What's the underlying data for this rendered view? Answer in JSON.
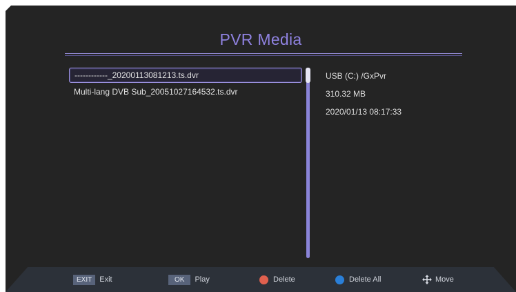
{
  "header": {
    "title": "PVR Media"
  },
  "files": [
    {
      "name": "------------_20200113081213.ts.dvr",
      "selected": true
    },
    {
      "name": "Multi-lang DVB Sub_20051027164532.ts.dvr",
      "selected": false
    }
  ],
  "details": {
    "path": "USB (C:) /GxPvr",
    "size": "310.32 MB",
    "datetime": "2020/01/13 08:17:33"
  },
  "footer": {
    "exit": {
      "key": "EXIT",
      "label": "Exit"
    },
    "ok": {
      "key": "OK",
      "label": "Play"
    },
    "delete": {
      "label": "Delete",
      "color": "#e0604e",
      "icon": "red-dot-icon"
    },
    "delete_all": {
      "label": "Delete All",
      "color": "#2a7fd8",
      "icon": "blue-dot-icon"
    },
    "move": {
      "label": "Move",
      "icon": "move-arrows-icon"
    }
  },
  "colors": {
    "accent": "#8f82e0",
    "background": "#242424",
    "footer": "#2c3139"
  }
}
